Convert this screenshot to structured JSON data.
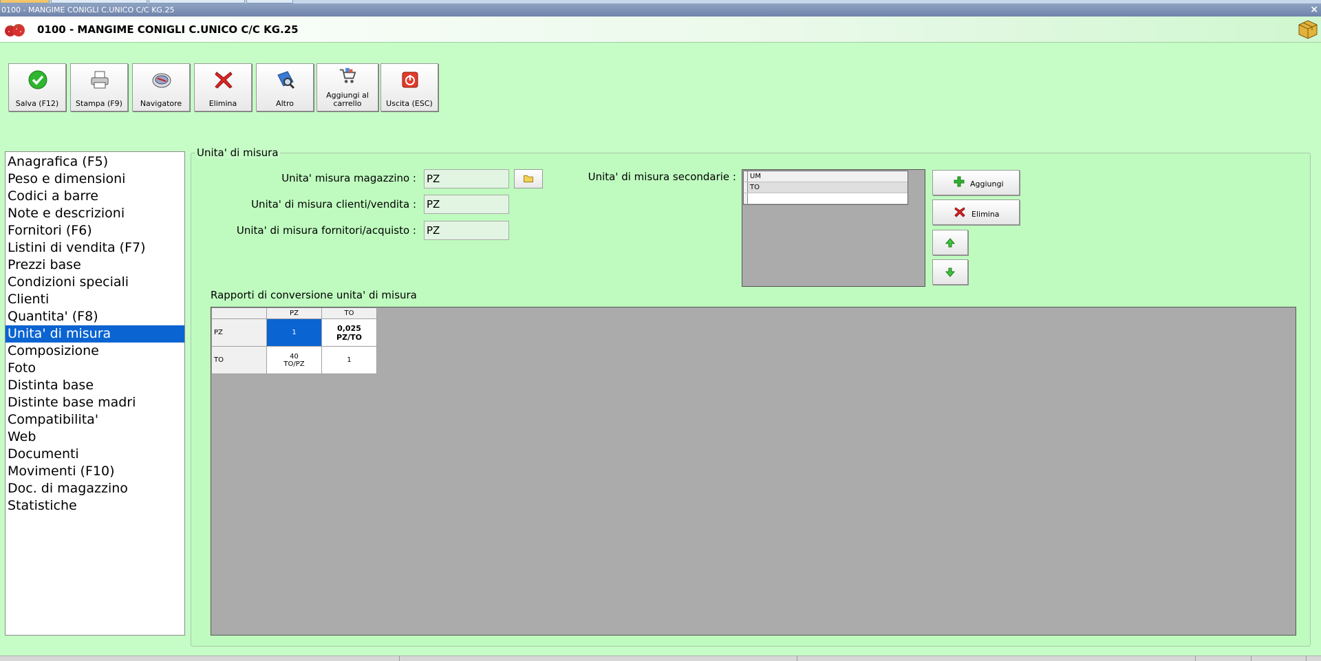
{
  "window": {
    "title": "0100 - MANGIME CONIGLI C.UNICO C/C KG.25",
    "close_glyph": "×"
  },
  "header": {
    "title": "0100 - MANGIME CONIGLI C.UNICO C/C KG.25",
    "logo_icon": "strawberries-icon",
    "right_icon": "package-cube-icon"
  },
  "toolbar": {
    "save": "Salva (F12)",
    "print": "Stampa (F9)",
    "navigator": "Navigatore",
    "delete": "Elimina",
    "other": "Altro",
    "cart_line1": "Aggiungi al",
    "cart_line2": "carrello",
    "exit": "Uscita (ESC)"
  },
  "nav": {
    "items": [
      "Anagrafica (F5)",
      "Peso e dimensioni",
      "Codici a barre",
      "Note e descrizioni",
      "Fornitori (F6)",
      "Listini di vendita (F7)",
      "Prezzi base",
      "Condizioni speciali",
      "Clienti",
      "Quantita' (F8)",
      "Unita' di misura",
      "Composizione",
      "Foto",
      "Distinta base",
      "Distinte base madri",
      "Compatibilita'",
      "Web",
      "Documenti",
      "Movimenti (F10)",
      "Doc. di magazzino",
      "Statistiche"
    ],
    "selected": "Unita' di misura"
  },
  "panel": {
    "legend": "Unita' di misura",
    "warehouse_label": "Unita' misura magazzino :",
    "warehouse_value": "PZ",
    "customers_label": "Unita' di misura clienti/vendita :",
    "customers_value": "PZ",
    "suppliers_label": "Unita' di misura fornitori/acquisto :",
    "suppliers_value": "PZ",
    "secondary_label": "Unita' di misura secondarie :",
    "secondary_header": "UM",
    "secondary_rows": [
      "TO",
      ""
    ],
    "add_button": "Aggiungi",
    "delete_button": "Elimina"
  },
  "conversion": {
    "caption": "Rapporti di conversione unita' di misura",
    "columns": [
      "PZ",
      "TO"
    ],
    "rows": [
      {
        "label": "PZ",
        "cells": [
          "1",
          "0,025\nPZ/TO"
        ]
      },
      {
        "label": "TO",
        "cells": [
          "40\nTO/PZ",
          "1"
        ]
      }
    ]
  },
  "colors": {
    "background": "#c6fcc6",
    "selection": "#0a64d2",
    "grid_empty": "#ababab"
  }
}
